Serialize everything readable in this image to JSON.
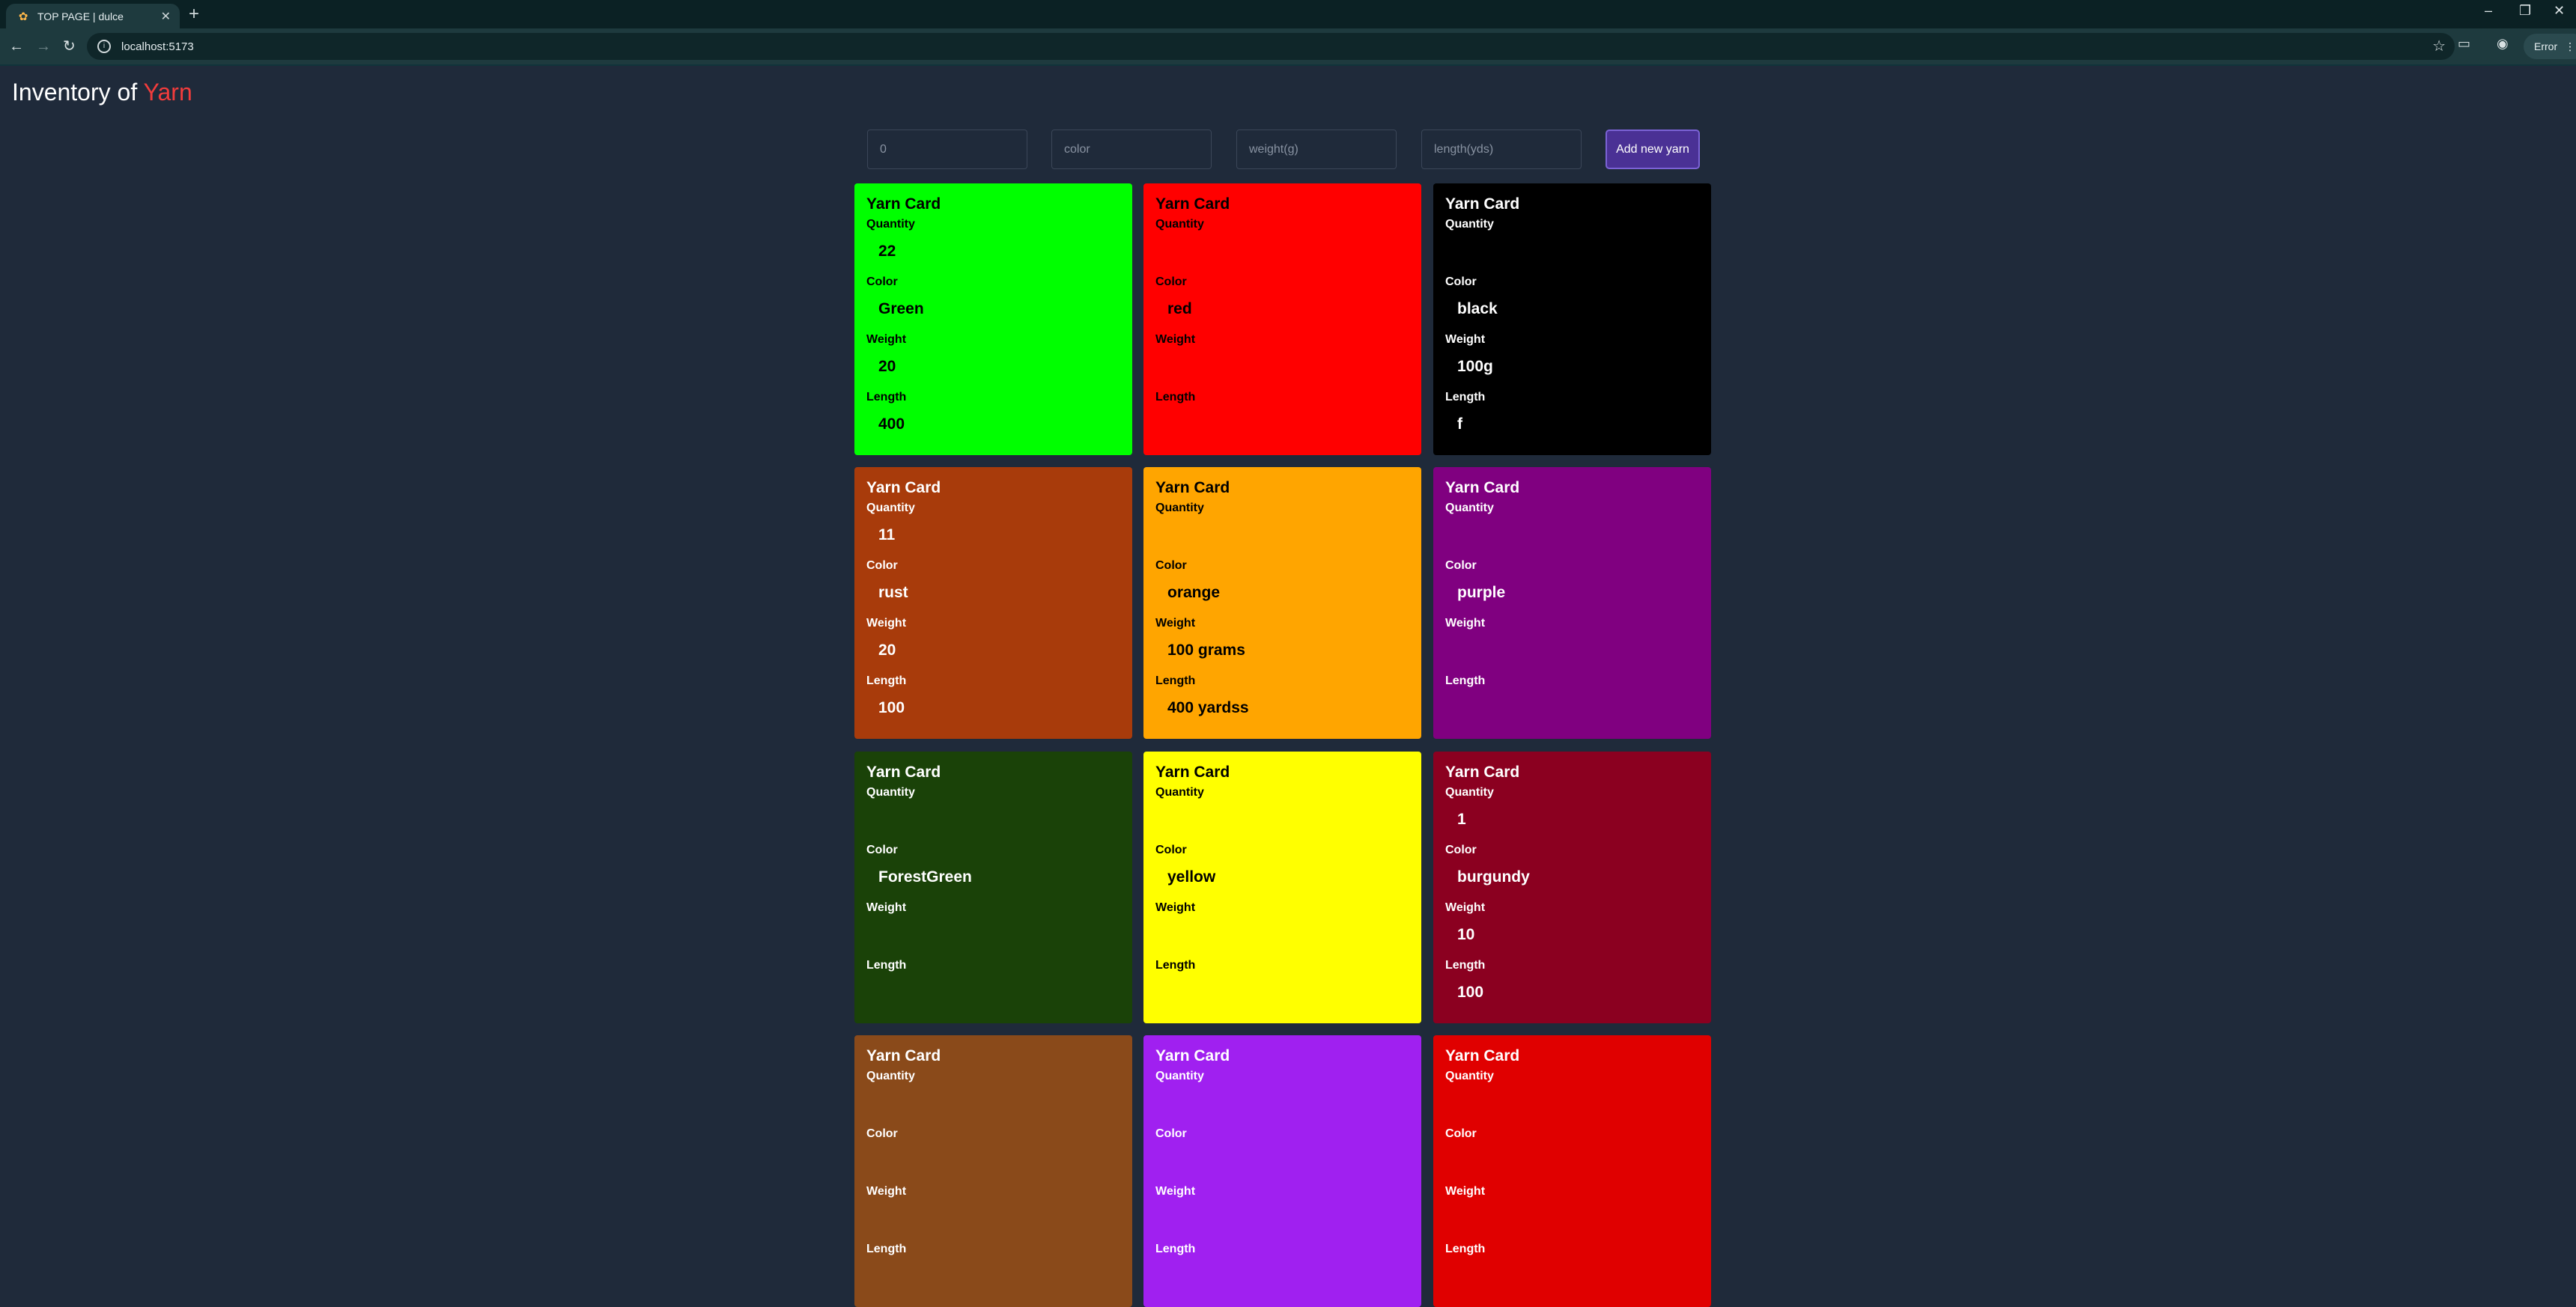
{
  "browser": {
    "tab_title": "TOP PAGE | dulce",
    "url": "localhost:5173",
    "profile_chip": "Error"
  },
  "page": {
    "heading_prefix": "Inventory of",
    "heading_accent": "Yarn"
  },
  "form": {
    "quantity_value": "0",
    "color_placeholder": "color",
    "weight_placeholder": "weight(g)",
    "length_placeholder": "length(yds)",
    "add_button": "Add new yarn"
  },
  "labels": {
    "card_title": "Yarn Card",
    "quantity": "Quantity",
    "color": "Color",
    "weight": "Weight",
    "length": "Length"
  },
  "cards": [
    {
      "bg": "#00ff00",
      "text": "#000000",
      "quantity": "22",
      "color": "Green",
      "weight": "20",
      "length": "400"
    },
    {
      "bg": "#ff0000",
      "text": "#000000",
      "quantity": "",
      "color": "red",
      "weight": "",
      "length": ""
    },
    {
      "bg": "#000000",
      "text": "#ffffff",
      "quantity": "",
      "color": "black",
      "weight": "100g",
      "length": "f"
    },
    {
      "bg": "#a83b0b",
      "text": "#ffffff",
      "quantity": "11",
      "color": "rust",
      "weight": "20",
      "length": "100"
    },
    {
      "bg": "#ffa500",
      "text": "#000000",
      "quantity": "",
      "color": "orange",
      "weight": "100 grams",
      "length": "400 yardss"
    },
    {
      "bg": "#800080",
      "text": "#ffffff",
      "quantity": "",
      "color": "purple",
      "weight": "",
      "length": ""
    },
    {
      "bg": "#1a4208",
      "text": "#ffffff",
      "quantity": "",
      "color": "ForestGreen",
      "weight": "",
      "length": ""
    },
    {
      "bg": "#ffff00",
      "text": "#000000",
      "quantity": "",
      "color": "yellow",
      "weight": "",
      "length": ""
    },
    {
      "bg": "#8b0020",
      "text": "#ffffff",
      "quantity": "1",
      "color": "burgundy",
      "weight": "10",
      "length": "100"
    },
    {
      "bg": "#8a4a1a",
      "text": "#ffffff",
      "quantity": "",
      "color": "",
      "weight": "",
      "length": ""
    },
    {
      "bg": "#a020f0",
      "text": "#ffffff",
      "quantity": "",
      "color": "",
      "weight": "",
      "length": ""
    },
    {
      "bg": "#e00000",
      "text": "#ffffff",
      "quantity": "",
      "color": "",
      "weight": "",
      "length": ""
    }
  ]
}
